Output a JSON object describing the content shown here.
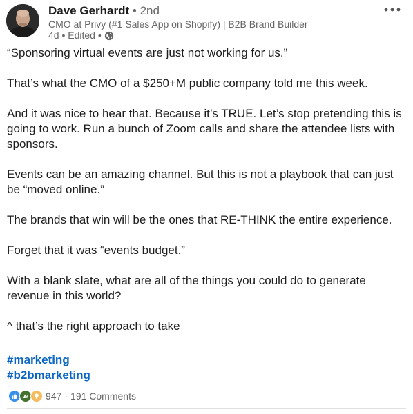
{
  "author": {
    "name": "Dave Gerhardt",
    "degree": "2nd",
    "headline": "CMO at Privy (#1 Sales App on Shopify) | B2B Brand Builder",
    "age": "4d",
    "edited": "Edited",
    "visibility_icon": "globe-icon"
  },
  "menu": {
    "more_icon": "ellipsis-icon"
  },
  "post": {
    "paragraphs": [
      "“Sponsoring virtual events are just not working for us.”",
      "That’s what the CMO of a $250+M public company told me this week.",
      "And it was nice to hear that. Because it’s TRUE. Let’s stop pretending this is going to work. Run a bunch of Zoom calls and share the attendee lists with sponsors.",
      "Events can be an amazing channel. But this is not a playbook that can just be “moved online.”",
      "The brands that win will be the ones that RE-THINK the entire experience.",
      "Forget that it was “events budget.”",
      "With a blank slate, what are all of the things you could do to generate revenue in this world?",
      "^ that’s the right approach to take"
    ],
    "hashtags": [
      "#marketing",
      "#b2bmarketing"
    ]
  },
  "social": {
    "reactions": [
      "like-icon",
      "celebrate-icon",
      "insightful-icon"
    ],
    "reaction_count": "947",
    "separator": "·",
    "comments": "191 Comments"
  },
  "colors": {
    "link": "#0a66c2",
    "muted": "#666666",
    "text": "#1d1d1d"
  }
}
